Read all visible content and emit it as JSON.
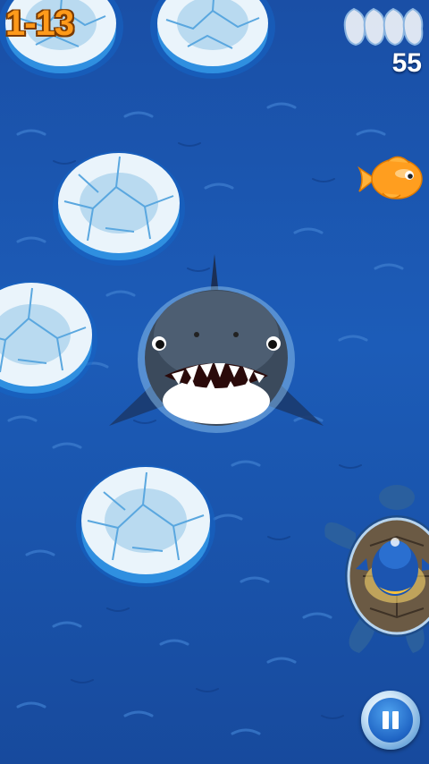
{
  "hud": {
    "level": "1-13",
    "score": "55",
    "lives_icons": "penguin-silhouette-icon",
    "lives_count": 4
  },
  "colors": {
    "sea": "#1c5cb8",
    "level_text": "#ff9a1a",
    "ice": "#eaf4fb",
    "ice_edge": "#2f8fe0",
    "fish": "#ff9e1f",
    "pause_button": "#1f64c4"
  },
  "sprites": {
    "ice_floes": 5,
    "shark": "shark-icon",
    "fish": "goldfish-icon",
    "player": "penguin-on-turtle-icon",
    "pause": "pause-icon"
  }
}
